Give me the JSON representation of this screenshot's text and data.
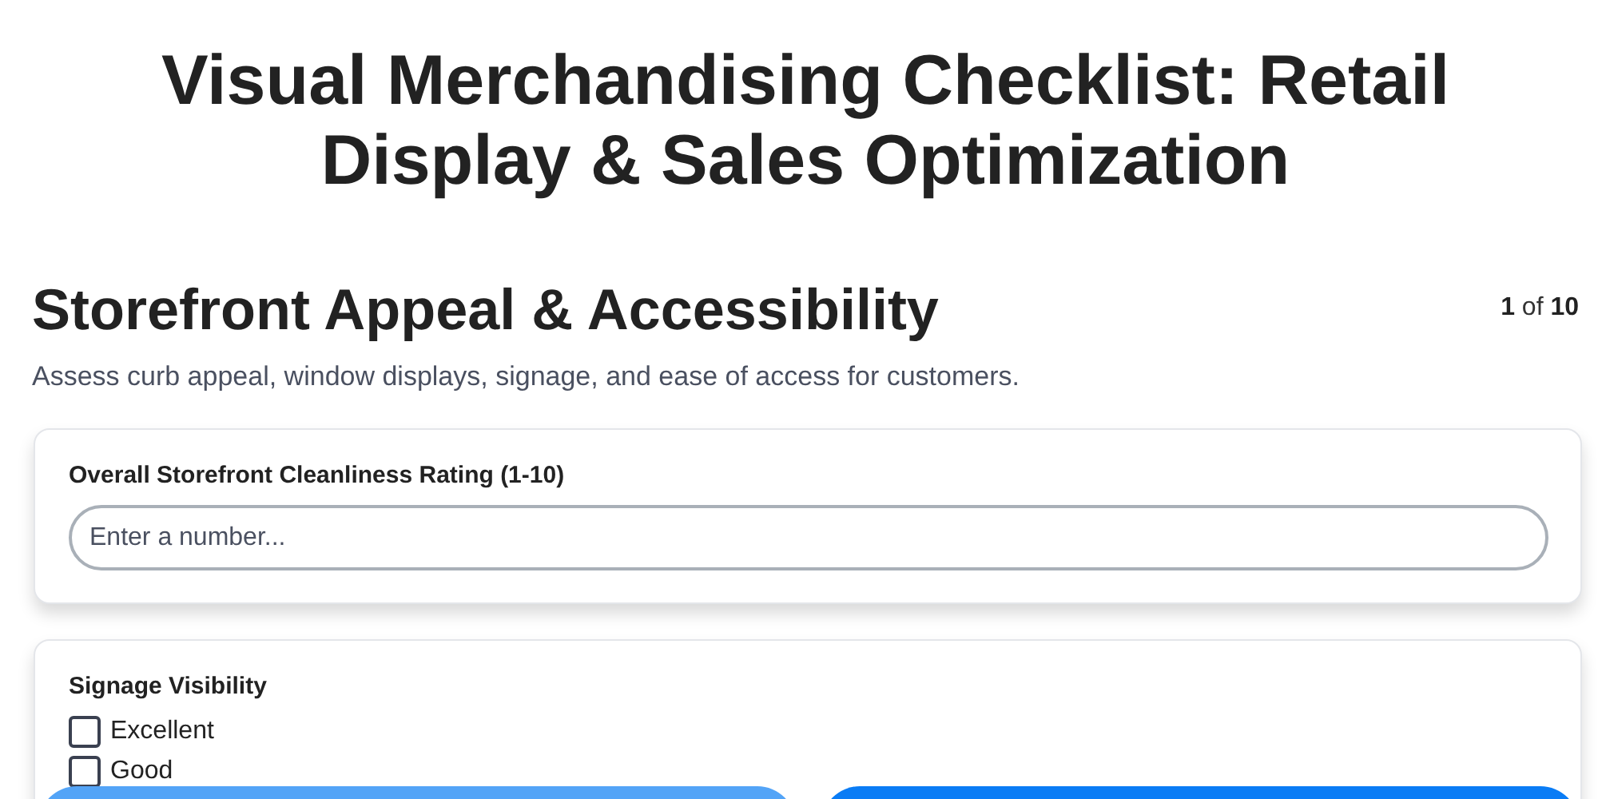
{
  "title": "Visual Merchandising Checklist: Retail Display & Sales Optimization",
  "section": {
    "heading": "Storefront Appeal & Accessibility",
    "progress": "**1** of **10**",
    "description": "Assess curb appeal, window displays, signage, and ease of access for customers."
  },
  "questions": [
    {
      "kind": "number",
      "label": "Overall Storefront Cleanliness Rating (1-10)",
      "placeholder": "Enter a number..."
    },
    {
      "kind": "checkbox",
      "label": "Signage Visibility",
      "options": [
        {
          "label": "Excellent",
          "checked": false
        },
        {
          "label": "Good",
          "checked": false
        }
      ]
    }
  ],
  "nav_buttons": [
    {
      "kind": "secondary"
    },
    {
      "kind": "primary"
    }
  ]
}
